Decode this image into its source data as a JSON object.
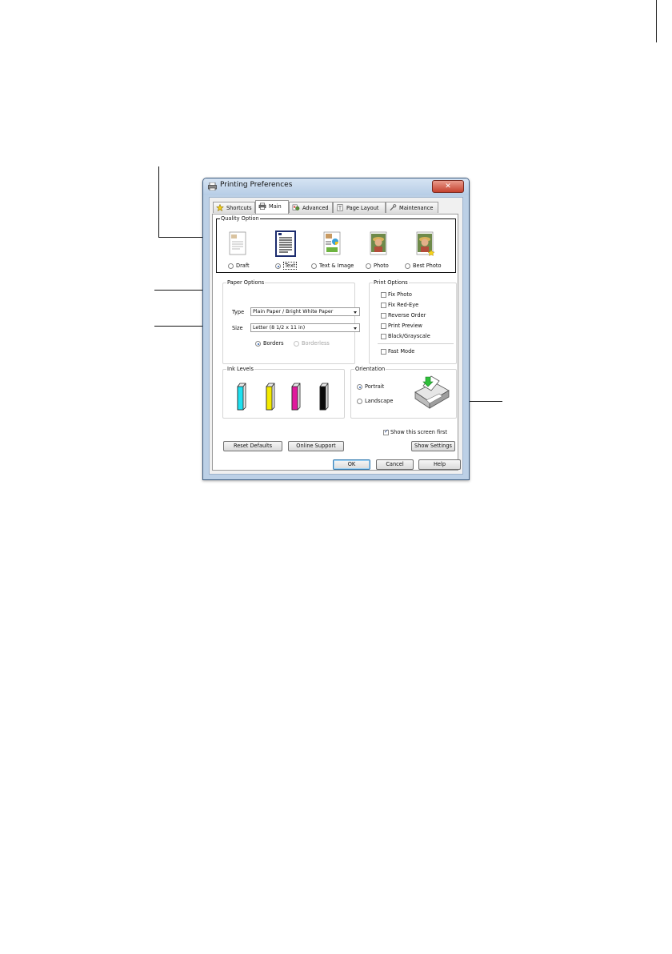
{
  "window": {
    "title": "Printing Preferences",
    "close_symbol": "✕"
  },
  "tabs": [
    {
      "label": "Shortcuts",
      "icon": "star-icon"
    },
    {
      "label": "Main",
      "icon": "printer-icon"
    },
    {
      "label": "Advanced",
      "icon": "advanced-icon"
    },
    {
      "label": "Page Layout",
      "icon": "page-layout-icon"
    },
    {
      "label": "Maintenance",
      "icon": "wrench-icon"
    }
  ],
  "active_tab": "Main",
  "quality_option": {
    "title": "Quality Option",
    "options": [
      {
        "label": "Draft",
        "selected": false
      },
      {
        "label": "Text",
        "selected": true
      },
      {
        "label": "Text & Image",
        "selected": false
      },
      {
        "label": "Photo",
        "selected": false
      },
      {
        "label": "Best Photo",
        "selected": false
      }
    ]
  },
  "paper_options": {
    "title": "Paper Options",
    "type_label": "Type",
    "type_value": "Plain Paper / Bright White Paper",
    "size_label": "Size",
    "size_value": "Letter (8 1/2 x 11 in)",
    "borders_label": "Borders",
    "borderless_label": "Borderless",
    "borders_selected": true
  },
  "print_options": {
    "title": "Print Options",
    "items": [
      "Fix Photo",
      "Fix Red-Eye",
      "Reverse Order",
      "Print Preview",
      "Black/Grayscale"
    ],
    "fast_mode": "Fast Mode"
  },
  "ink_levels": {
    "title": "Ink Levels",
    "colors": [
      "#1ee0f0",
      "#f3ea00",
      "#e0199c",
      "#0a0a0a"
    ]
  },
  "orientation": {
    "title": "Orientation",
    "portrait": "Portrait",
    "landscape": "Landscape",
    "selected": "Portrait"
  },
  "show_this_screen_first": {
    "label": "Show this screen first",
    "checked": true
  },
  "buttons": {
    "reset_defaults": "Reset Defaults",
    "online_support": "Online Support",
    "show_settings": "Show Settings",
    "ok": "OK",
    "cancel": "Cancel",
    "help": "Help"
  }
}
